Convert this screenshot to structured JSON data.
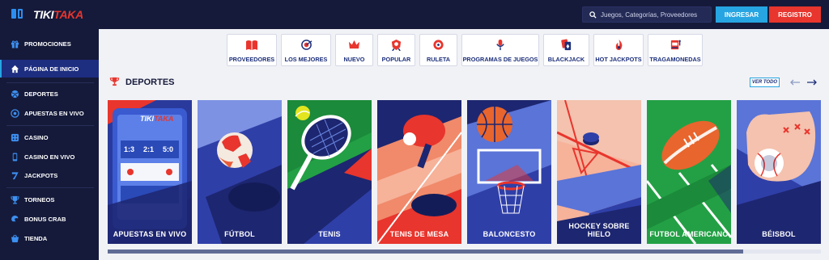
{
  "header": {
    "logo_part1": "TIKI",
    "logo_part2": "TAKA",
    "search_placeholder": "Juegos, Categorías, Proveedores",
    "login_label": "INGRESAR",
    "register_label": "REGISTRO"
  },
  "sidebar": {
    "items": [
      {
        "label": "PROMOCIONES",
        "icon": "gift-icon"
      },
      {
        "label": "PÁGINA DE INICIO",
        "icon": "home-icon",
        "active": true
      },
      {
        "label": "DEPORTES",
        "icon": "ball-icon"
      },
      {
        "label": "APUESTAS EN VIVO",
        "icon": "live-icon"
      },
      {
        "label": "CASINO",
        "icon": "casino-icon"
      },
      {
        "label": "CASINO EN VIVO",
        "icon": "phone-icon"
      },
      {
        "label": "JACKPOTS",
        "icon": "seven-icon"
      },
      {
        "label": "TORNEOS",
        "icon": "trophy-icon"
      },
      {
        "label": "BONUS CRAB",
        "icon": "crab-icon"
      },
      {
        "label": "TIENDA",
        "icon": "basket-icon"
      }
    ]
  },
  "categories": [
    {
      "label": "PROVEEDORES",
      "icon": "book-icon"
    },
    {
      "label": "LOS MEJORES",
      "icon": "target-icon"
    },
    {
      "label": "NUEVO",
      "icon": "crown-icon"
    },
    {
      "label": "POPULAR",
      "icon": "badge-icon"
    },
    {
      "label": "RULETA",
      "icon": "roulette-icon"
    },
    {
      "label": "PROGRAMAS DE JUEGOS",
      "icon": "microphone-icon"
    },
    {
      "label": "BLACKJACK",
      "icon": "cards-icon"
    },
    {
      "label": "HOT JACKPOTS",
      "icon": "fire-icon"
    },
    {
      "label": "TRAGAMONEDAS",
      "icon": "slot-icon"
    }
  ],
  "section": {
    "title": "DEPORTES",
    "view_all": "VER TODO"
  },
  "sports": [
    {
      "label": "APUESTAS EN VIVO",
      "app_logo_1": "TIKI",
      "app_logo_2": "TAKA",
      "scores": [
        "1:3",
        "2:1",
        "5:0"
      ]
    },
    {
      "label": "FÚTBOL"
    },
    {
      "label": "TENIS"
    },
    {
      "label": "TENIS DE MESA"
    },
    {
      "label": "BALONCESTO"
    },
    {
      "label": "HOCKEY SOBRE HIELO"
    },
    {
      "label": "FUTBOL AMERICANO"
    },
    {
      "label": "BÉISBOL"
    }
  ],
  "colors": {
    "navy": "#151a3a",
    "blue": "#26a5e2",
    "red": "#e8352d",
    "text_blue": "#1c2f7a"
  }
}
